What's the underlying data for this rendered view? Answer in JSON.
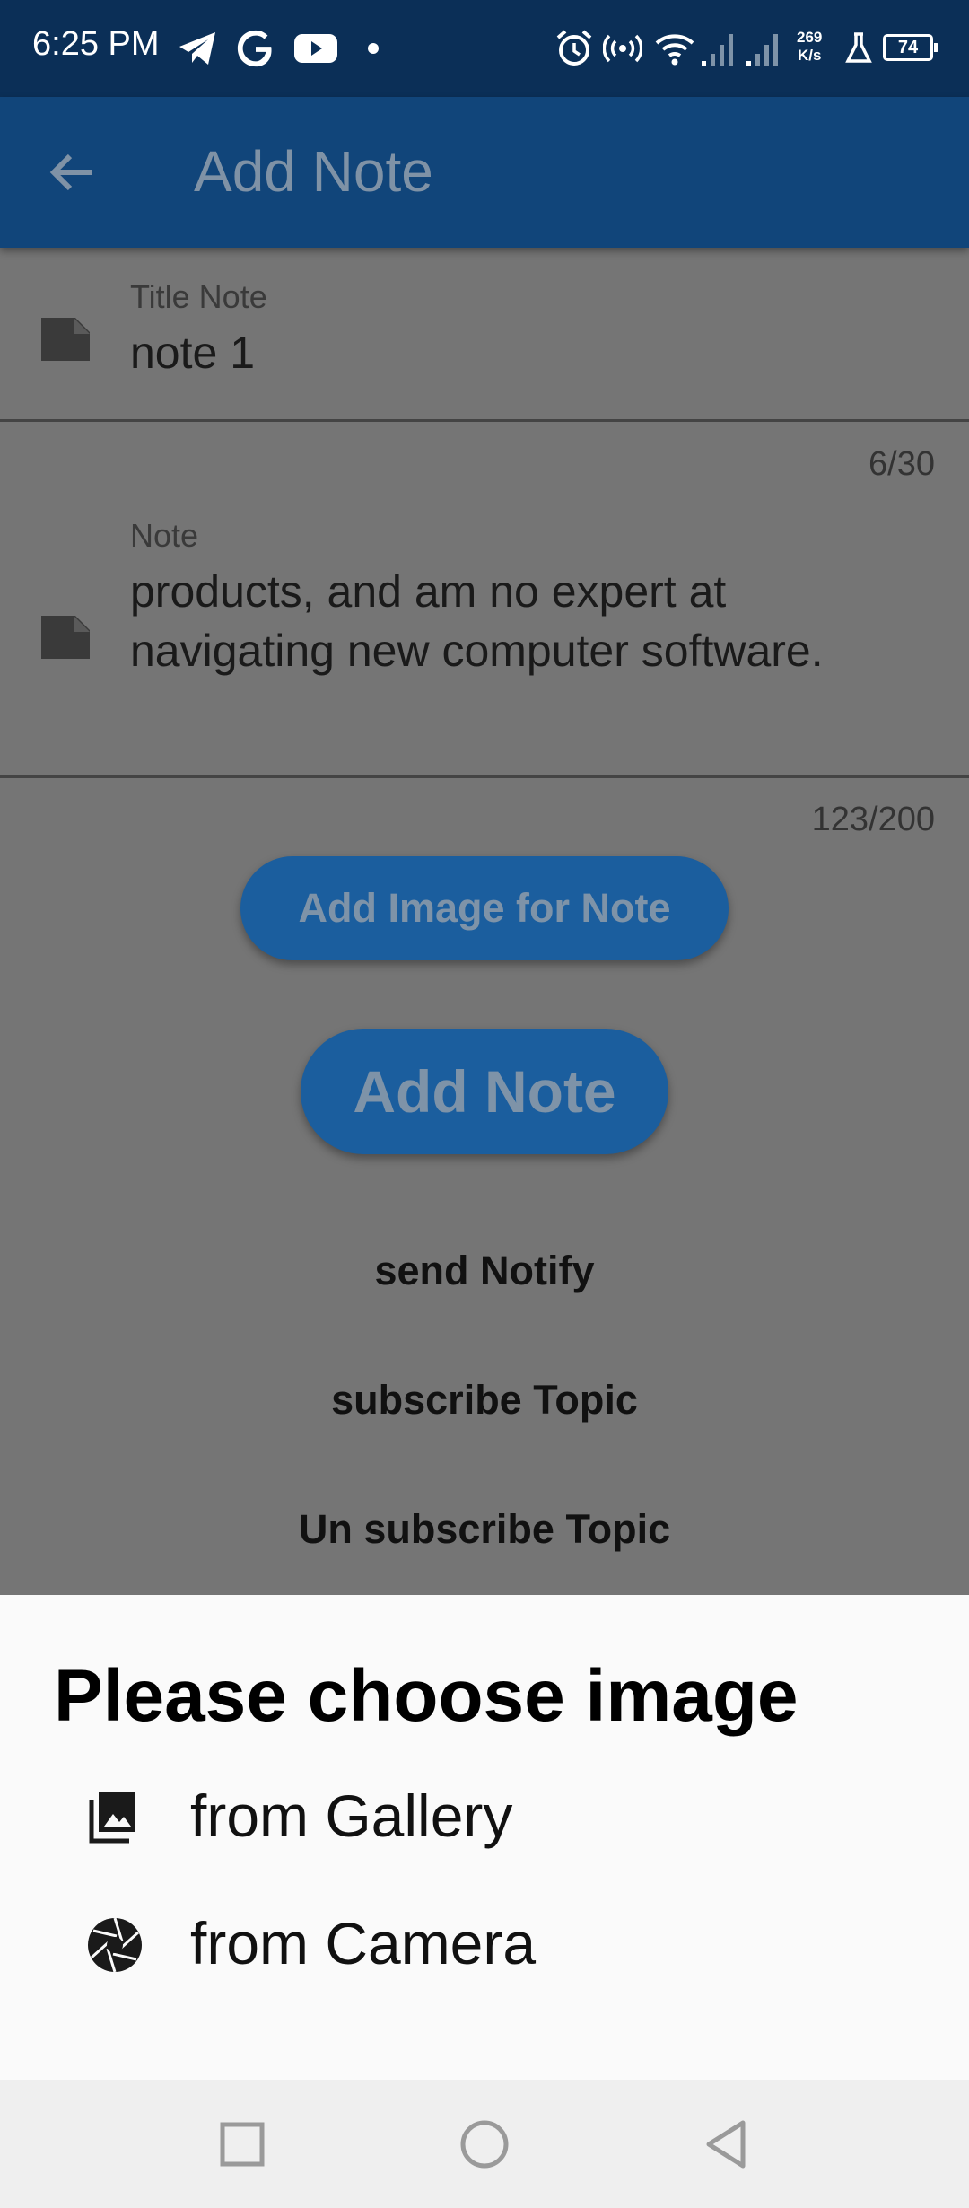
{
  "status_bar": {
    "time": "6:25 PM",
    "net_speed_value": "269",
    "net_speed_unit": "K/s",
    "battery": "74",
    "icons": [
      "telegram-icon",
      "google-icon",
      "youtube-icon",
      "dot-icon",
      "alarm-icon",
      "hotspot-icon",
      "wifi-icon",
      "signal-icon",
      "signal-icon",
      "lab-icon",
      "battery-icon"
    ]
  },
  "app_bar": {
    "title": "Add Note",
    "back_icon": "arrow-back-icon"
  },
  "form": {
    "title_field": {
      "label": "Title Note",
      "value": "note 1",
      "counter": "6/30",
      "icon": "note-icon"
    },
    "note_field": {
      "label": "Note",
      "value": "products, and am no expert at navigating new computer software.",
      "counter": "123/200",
      "icon": "note-icon"
    },
    "add_image_button": "Add Image for Note",
    "add_note_button": "Add Note",
    "send_notify": "send Notify",
    "subscribe_topic": "subscribe Topic",
    "unsubscribe_topic": "Un subscribe Topic"
  },
  "bottom_sheet": {
    "title": "Please choose image",
    "options": [
      {
        "label": "from Gallery",
        "icon": "image-icon"
      },
      {
        "label": "from Camera",
        "icon": "camera-shutter-icon"
      }
    ]
  },
  "nav_bar": {
    "icons": [
      "recents-square-icon",
      "home-circle-icon",
      "back-triangle-icon"
    ]
  },
  "colors": {
    "status_bar": "#0b2f57",
    "app_bar": "#11457a",
    "scrim": "#757575",
    "button": "#1b5e9e",
    "sheet": "#fafafa"
  }
}
